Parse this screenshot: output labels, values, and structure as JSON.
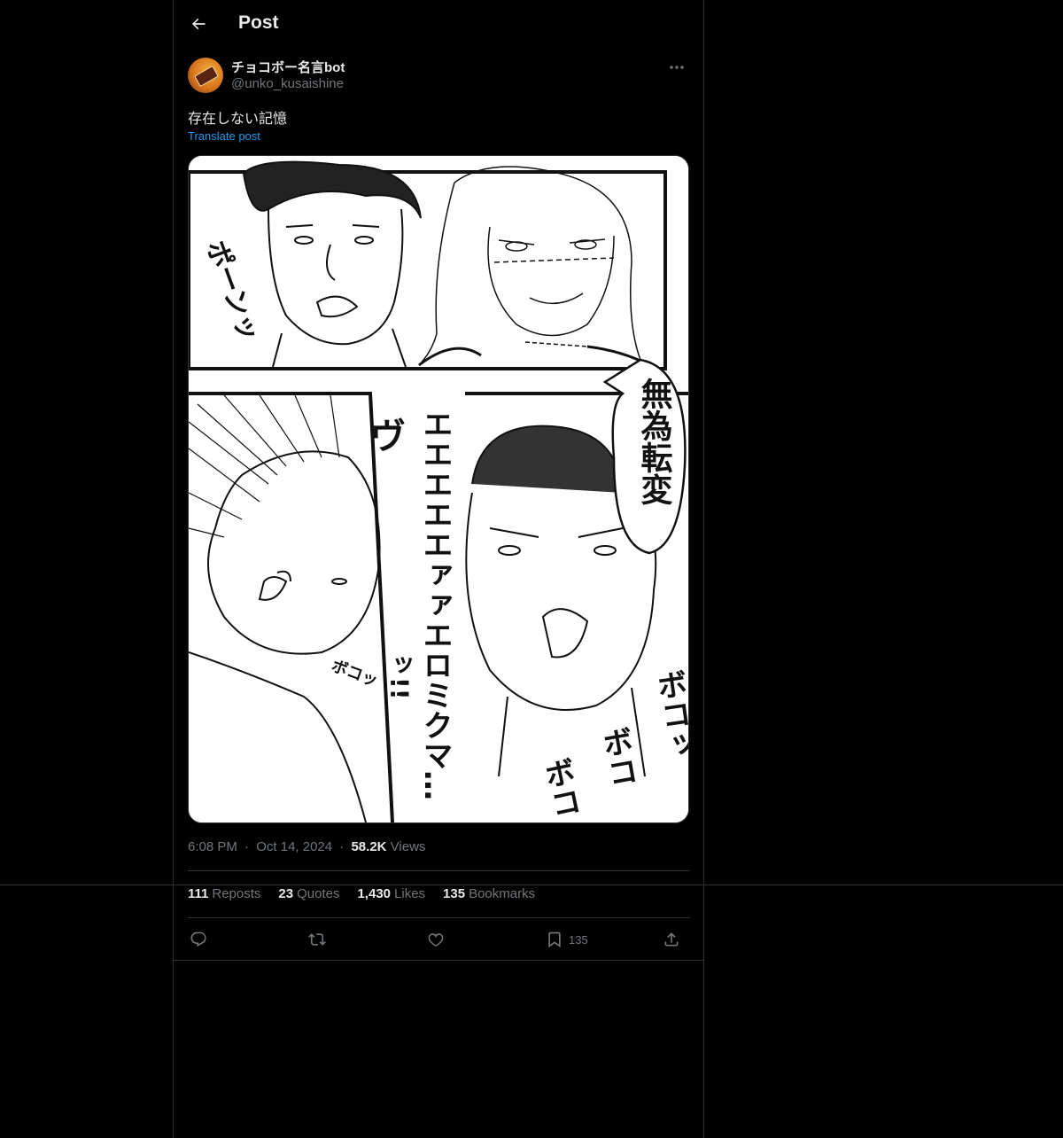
{
  "header": {
    "title": "Post"
  },
  "post": {
    "author_name": "チョコボー名言bot",
    "author_handle": "@unko_kusaishine",
    "text": "存在しない記憶",
    "translate_label": "Translate post",
    "time": "6:08 PM",
    "date": "Oct 14, 2024",
    "views_count": "58.2K",
    "views_label": "Views",
    "separator": "·"
  },
  "manga": {
    "sfx_top_left": "ポーンッ",
    "speech_bubble": "無為転変",
    "sfx_scream": "エエエエエァァエロミクマ…",
    "sfx_vu": "ヴ",
    "sfx_exclaim": "ッ!!",
    "sfx_small": "ボコッ",
    "sfx_boko_1": "ボコッ",
    "sfx_boko_2": "ボコ",
    "sfx_boko_3": "ボコ"
  },
  "stats": {
    "reposts_count": "111",
    "reposts_label": "Reposts",
    "quotes_count": "23",
    "quotes_label": "Quotes",
    "likes_count": "1,430",
    "likes_label": "Likes",
    "bookmarks_count": "135",
    "bookmarks_label": "Bookmarks"
  },
  "actions": {
    "reply_icon": "reply-icon",
    "repost_icon": "repost-icon",
    "like_icon": "heart-icon",
    "bookmark_icon": "bookmark-icon",
    "bookmark_count": "135",
    "share_icon": "share-icon"
  },
  "colors": {
    "background": "#000000",
    "text_primary": "#e7e9ea",
    "text_secondary": "#71767b",
    "link": "#1d9bf0",
    "border": "#2f3336"
  }
}
